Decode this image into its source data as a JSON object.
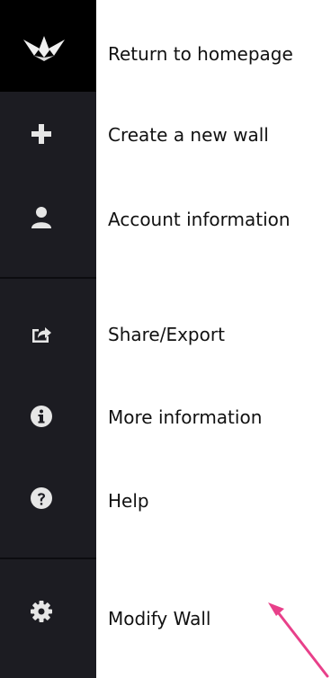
{
  "colors": {
    "sidebar_bg": "#1c1c22",
    "logo_bg": "#000000",
    "icon_color": "#e6e6e6",
    "label_color": "#111111",
    "annotation_arrow": "#e8408a"
  },
  "menu": {
    "items": [
      {
        "id": "home",
        "label": "Return to homepage",
        "icon": "origami-crane-logo-icon"
      },
      {
        "id": "create",
        "label": "Create a new wall",
        "icon": "plus-icon"
      },
      {
        "id": "account",
        "label": "Account information",
        "icon": "user-icon"
      },
      {
        "id": "share",
        "label": "Share/Export",
        "icon": "share-export-icon"
      },
      {
        "id": "info",
        "label": "More information",
        "icon": "info-icon"
      },
      {
        "id": "help",
        "label": "Help",
        "icon": "help-icon"
      },
      {
        "id": "modify",
        "label": "Modify Wall",
        "icon": "gear-icon"
      }
    ]
  },
  "annotation": {
    "icon": "pink-arrow-icon"
  }
}
